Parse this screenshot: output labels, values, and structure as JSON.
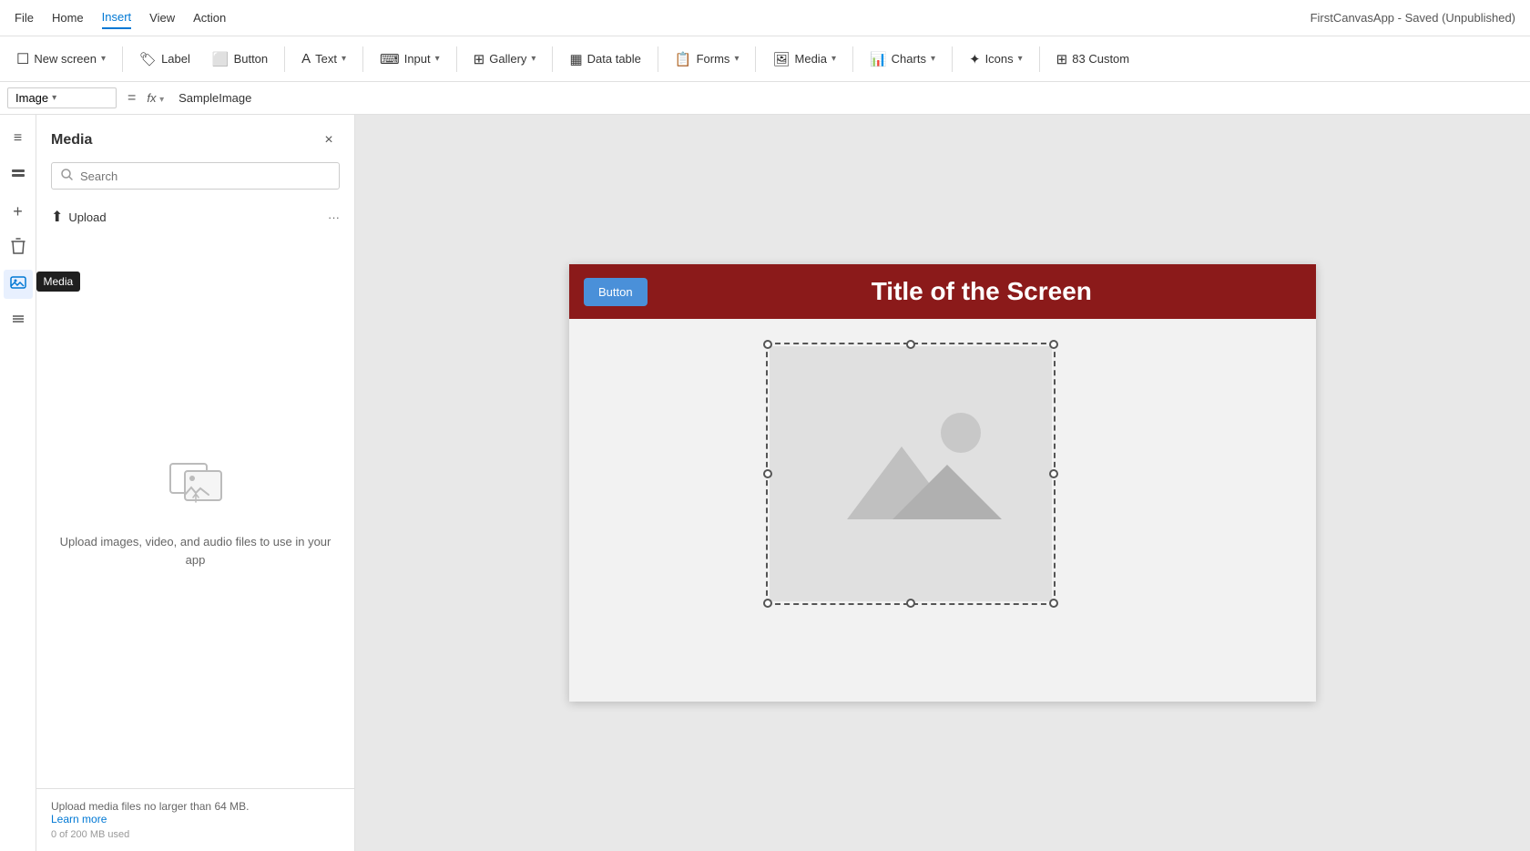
{
  "app": {
    "title": "FirstCanvasApp - Saved (Unpublished)"
  },
  "menu": {
    "items": [
      "File",
      "Home",
      "Insert",
      "View",
      "Action"
    ],
    "active": "Insert"
  },
  "toolbar": {
    "new_screen_label": "New screen",
    "label_label": "Label",
    "button_label": "Button",
    "text_label": "Text",
    "input_label": "Input",
    "gallery_label": "Gallery",
    "data_table_label": "Data table",
    "forms_label": "Forms",
    "media_label": "Media",
    "charts_label": "Charts",
    "icons_label": "Icons",
    "custom_label": "83   Custom"
  },
  "formula_bar": {
    "dropdown_label": "Image",
    "equals_symbol": "=",
    "fx_label": "fx",
    "formula_value": "SampleImage"
  },
  "sidebar_icons": {
    "hamburger": "≡",
    "layers": "⊞",
    "add": "+",
    "trash": "🗑",
    "media": "🖼",
    "grid": "⊞"
  },
  "media_panel": {
    "title": "Media",
    "close_label": "×",
    "search_placeholder": "Search",
    "upload_label": "Upload",
    "more_label": "···",
    "empty_text": "Upload images, video, and audio files to use in your app",
    "footer_text": "Upload media files no larger than 64 MB.",
    "footer_link": "Learn more",
    "footer_size": "0 of 200 MB used"
  },
  "canvas": {
    "button_label": "Button",
    "title": "Title of the Screen",
    "header_bg": "#8b1a1a",
    "button_bg": "#4a90d9"
  },
  "tooltip": {
    "label": "Media"
  }
}
